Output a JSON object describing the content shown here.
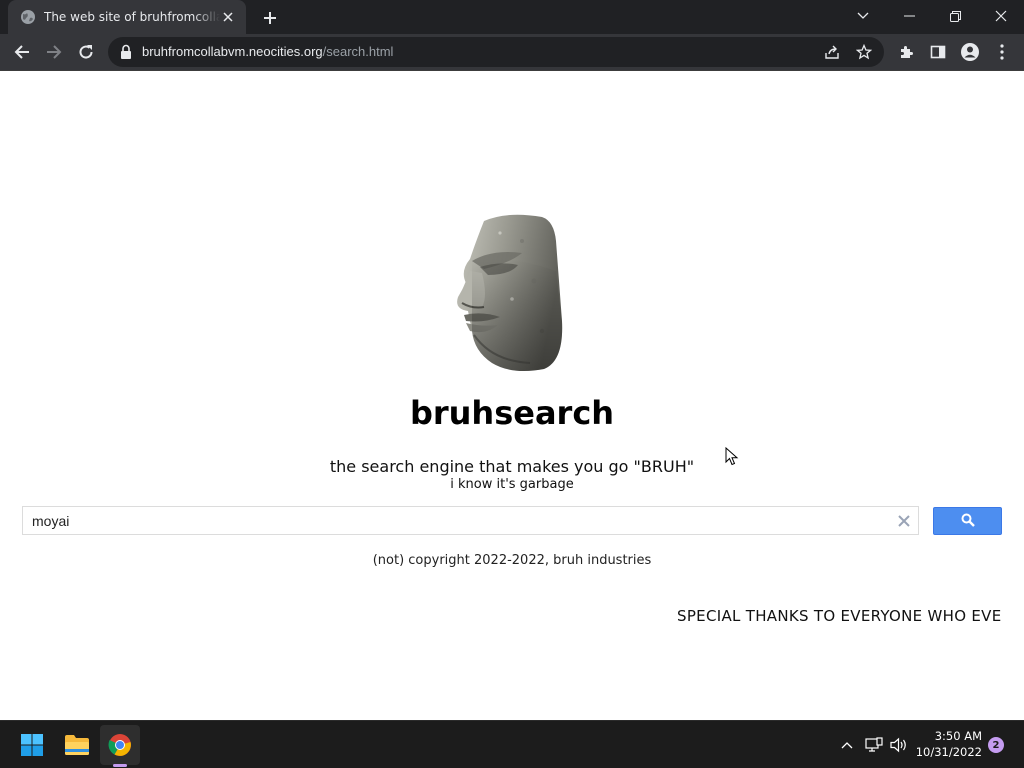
{
  "browser": {
    "tab": {
      "title": "The web site of bruhfromcollabvm",
      "favicon": "globe-icon"
    },
    "address": {
      "host": "bruhfromcollabvm.neocities.org",
      "path": "/search.html"
    },
    "theme": {
      "frame": "#202124",
      "toolbar": "#35363a",
      "omnibox": "#202124"
    }
  },
  "page": {
    "logo_image": "moai-head",
    "brand": "bruhsearch",
    "tagline": "the search engine that makes you go \"BRUH\"",
    "subtagline": "i know it's garbage",
    "search": {
      "value": "moyai",
      "button_icon": "search-icon",
      "button_color": "#4d8ef0"
    },
    "copyright": "(not) copyright 2022-2022, bruh industries",
    "marquee": "SPECIAL THANKS TO EVERYONE WHO EVE"
  },
  "taskbar": {
    "apps": [
      "start-icon",
      "file-explorer-icon",
      "chrome-icon"
    ],
    "clock": {
      "time": "3:50 AM",
      "date": "10/31/2022"
    },
    "notifications": "2"
  }
}
